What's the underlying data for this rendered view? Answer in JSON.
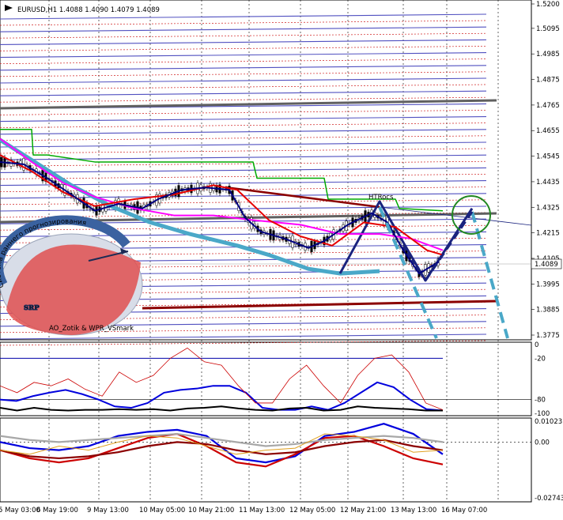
{
  "window": {
    "title": "EURUSD,H1  1.4088 1.4090 1.4079 1.4089"
  },
  "logo": {
    "big": "SRP",
    "arc_text": "Система раннего прогнозирования",
    "credit": "AO_Zotik & WPR_VSmark"
  },
  "chart_data": [
    {
      "type": "line",
      "panel": "price",
      "symbol": "EURUSD",
      "timeframe": "H1",
      "ohlc": {
        "open": 1.4088,
        "high": 1.409,
        "low": 1.4079,
        "close": 1.4089
      },
      "current_price_label": "1.4089",
      "y_ticks": [
        "1.5200",
        "1.5095",
        "1.4985",
        "1.4875",
        "1.4765",
        "1.4655",
        "1.4545",
        "1.4435",
        "1.4325",
        "1.4215",
        "1.4105",
        "1.3995",
        "1.3885",
        "1.3775"
      ],
      "ylim": [
        1.3775,
        1.52
      ],
      "x_ticks": [
        "5 May 03:00",
        "6 May 19:00",
        "9 May 13:00",
        "10 May 05:00",
        "10 May 21:00",
        "11 May 13:00",
        "12 May 05:00",
        "12 May 21:00",
        "13 May 13:00",
        "16 May 07:00"
      ],
      "annotation": "HTRocs",
      "series": [
        {
          "color": "#4aa8c8",
          "x": [
            0,
            44,
            90,
            140,
            190,
            240,
            300,
            340,
            390,
            430,
            480
          ],
          "values": [
            1.4615,
            1.452,
            1.442,
            1.433,
            1.426,
            1.421,
            1.416,
            1.412,
            1.406,
            1.404,
            1.405
          ]
        },
        {
          "color": "#1a237e",
          "x": [
            430,
            480,
            538,
            597
          ],
          "values": [
            1.404,
            1.435,
            1.401,
            1.432
          ]
        },
        {
          "color": "#ff00ff",
          "x": [
            0,
            40,
            80,
            120,
            170,
            220,
            270,
            320,
            380,
            430,
            480,
            520,
            560
          ],
          "values": [
            1.462,
            1.452,
            1.443,
            1.437,
            1.432,
            1.429,
            1.429,
            1.427,
            1.425,
            1.421,
            1.421,
            1.419,
            1.414
          ]
        },
        {
          "color": "#e60000",
          "x": [
            0,
            40,
            80,
            120,
            170,
            220,
            270,
            300,
            340,
            380,
            420,
            460,
            500,
            540,
            560
          ],
          "values": [
            1.455,
            1.448,
            1.439,
            1.433,
            1.436,
            1.438,
            1.442,
            1.44,
            1.427,
            1.42,
            1.416,
            1.426,
            1.424,
            1.414,
            1.412
          ]
        },
        {
          "color": "#00aa00",
          "x": [
            0,
            40,
            42,
            60,
            120,
            200,
            320,
            325,
            410,
            415,
            500,
            505,
            560
          ],
          "values": [
            1.466,
            1.466,
            1.455,
            1.455,
            1.452,
            1.452,
            1.452,
            1.445,
            1.445,
            1.436,
            1.436,
            1.432,
            1.431
          ]
        },
        {
          "color": "#000080",
          "x": [
            0,
            30,
            60,
            90,
            120,
            150,
            180,
            200,
            230,
            260,
            290,
            310,
            330,
            360,
            390,
            410,
            440,
            470,
            490,
            510,
            530,
            545,
            555
          ],
          "values": [
            1.452,
            1.451,
            1.445,
            1.438,
            1.431,
            1.434,
            1.432,
            1.436,
            1.44,
            1.441,
            1.44,
            1.428,
            1.422,
            1.419,
            1.415,
            1.418,
            1.425,
            1.43,
            1.426,
            1.414,
            1.404,
            1.407,
            1.409
          ]
        }
      ]
    },
    {
      "type": "line",
      "panel": "oscillator-1",
      "y_ticks": [
        "0",
        "-20",
        "-80",
        "-100"
      ],
      "ylim": [
        -100,
        0
      ],
      "series": [
        {
          "color": "#0000dd",
          "values": [
            -80,
            -82,
            -75,
            -70,
            -66,
            -72,
            -80,
            -90,
            -92,
            -85,
            -70,
            -66,
            -64,
            -60,
            -60,
            -70,
            -92,
            -95,
            -95,
            -90,
            -95,
            -85,
            -70,
            -55,
            -62,
            -80,
            -94,
            -96
          ]
        },
        {
          "color": "#000000",
          "values": [
            -92,
            -96,
            -92,
            -95,
            -96,
            -95,
            -95,
            -94,
            -95,
            -94,
            -96,
            -93,
            -92,
            -90,
            -93,
            -95,
            -96,
            -93,
            -92,
            -96,
            -95,
            -90,
            -92,
            -93,
            -94,
            -96,
            -96
          ]
        },
        {
          "color": "#cc0000",
          "values": [
            -60,
            -70,
            -55,
            -60,
            -50,
            -65,
            -75,
            -40,
            -55,
            -45,
            -20,
            -5,
            -25,
            -30,
            -60,
            -85,
            -85,
            -50,
            -30,
            -60,
            -85,
            -45,
            -20,
            -15,
            -40,
            -85,
            -95
          ]
        }
      ]
    },
    {
      "type": "line",
      "panel": "oscillator-2",
      "y_ticks": [
        "0.01023",
        "0.00",
        "-0.02743"
      ],
      "ylim": [
        -0.02743,
        0.01023
      ],
      "series": [
        {
          "color": "#0000dd",
          "values": [
            0,
            -0.003,
            -0.004,
            -0.002,
            0.003,
            0.005,
            0.006,
            0.003,
            -0.008,
            -0.01,
            -0.007,
            0.003,
            0.005,
            0.009,
            0.004,
            -0.006
          ]
        },
        {
          "color": "#cc0000",
          "values": [
            -0.004,
            -0.008,
            -0.01,
            -0.008,
            -0.003,
            0.002,
            0.004,
            -0.002,
            -0.01,
            -0.012,
            -0.006,
            0.002,
            0.003,
            -0.002,
            -0.008,
            -0.011
          ]
        },
        {
          "color": "#8b0000",
          "values": [
            -0.004,
            -0.007,
            -0.008,
            -0.007,
            -0.005,
            -0.002,
            0,
            -0.001,
            -0.004,
            -0.006,
            -0.005,
            -0.002,
            0,
            0.001,
            -0.002,
            -0.004
          ]
        },
        {
          "color": "#a8a8a8",
          "values": [
            0.003,
            0.001,
            0,
            0.001,
            0.002,
            0.003,
            0.004,
            0.002,
            0,
            -0.002,
            -0.001,
            0.001,
            0.002,
            0.003,
            0.002,
            0
          ]
        },
        {
          "color": "#e0a020",
          "values": [
            -0.004,
            -0.006,
            -0.002,
            -0.004,
            0,
            0.003,
            0.002,
            -0.002,
            -0.006,
            -0.004,
            -0.003,
            0.004,
            0.003,
            0.001,
            -0.005,
            -0.004
          ]
        }
      ]
    }
  ]
}
